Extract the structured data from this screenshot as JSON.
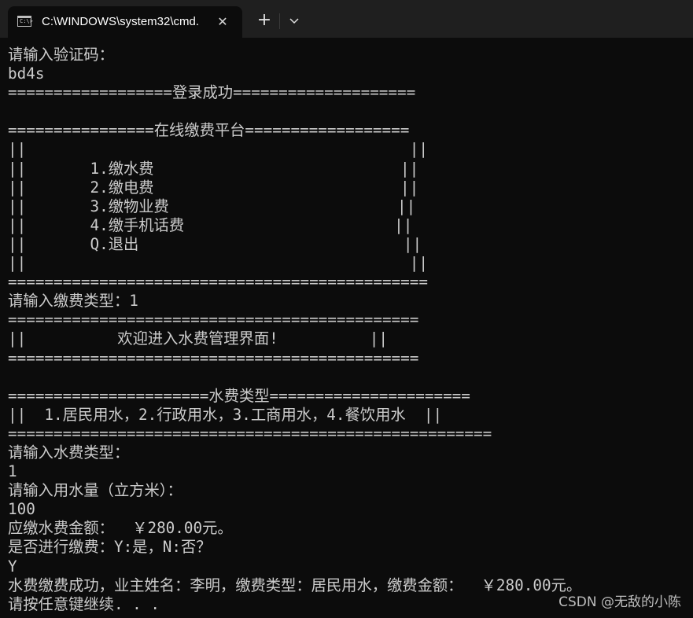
{
  "window": {
    "tab_title": "C:\\WINDOWS\\system32\\cmd.",
    "tab_icon": "terminal-icon",
    "close_icon": "close-icon",
    "new_tab_icon": "plus-icon",
    "dropdown_icon": "chevron-down-icon",
    "tab_icon_prompt": "C:\\>"
  },
  "console": {
    "lines": [
      "请输入验证码：",
      "bd4s",
      "==================登录成功====================",
      "",
      "================在线缴费平台==================",
      "||                                          ||",
      "||       1.缴水费                           ||",
      "||       2.缴电费                           ||",
      "||       3.缴物业费                         ||",
      "||       4.缴手机话费                       ||",
      "||       Q.退出                             ||",
      "||                                          ||",
      "==============================================",
      "请输入缴费类型：1",
      "=============================================",
      "||          欢迎进入水费管理界面!          ||",
      "=============================================",
      "",
      "======================水费类型======================",
      "||  1.居民用水，2.行政用水，3.工商用水，4.餐饮用水  ||",
      "=====================================================",
      "请输入水费类型：",
      "1",
      "请输入用水量（立方米）：",
      "100",
      "应缴水费金额：  ￥280.00元。",
      "是否进行缴费：Y:是，N:否？",
      "Y",
      "水费缴费成功，业主姓名：李明，缴费类型：居民用水，缴费金额：  ￥280.00元。",
      "请按任意键继续. . ."
    ]
  },
  "watermark": "CSDN @无敌的小陈",
  "colors": {
    "background": "#0c0c0c",
    "titlebar": "#1f1f1f",
    "text": "#cccccc"
  }
}
